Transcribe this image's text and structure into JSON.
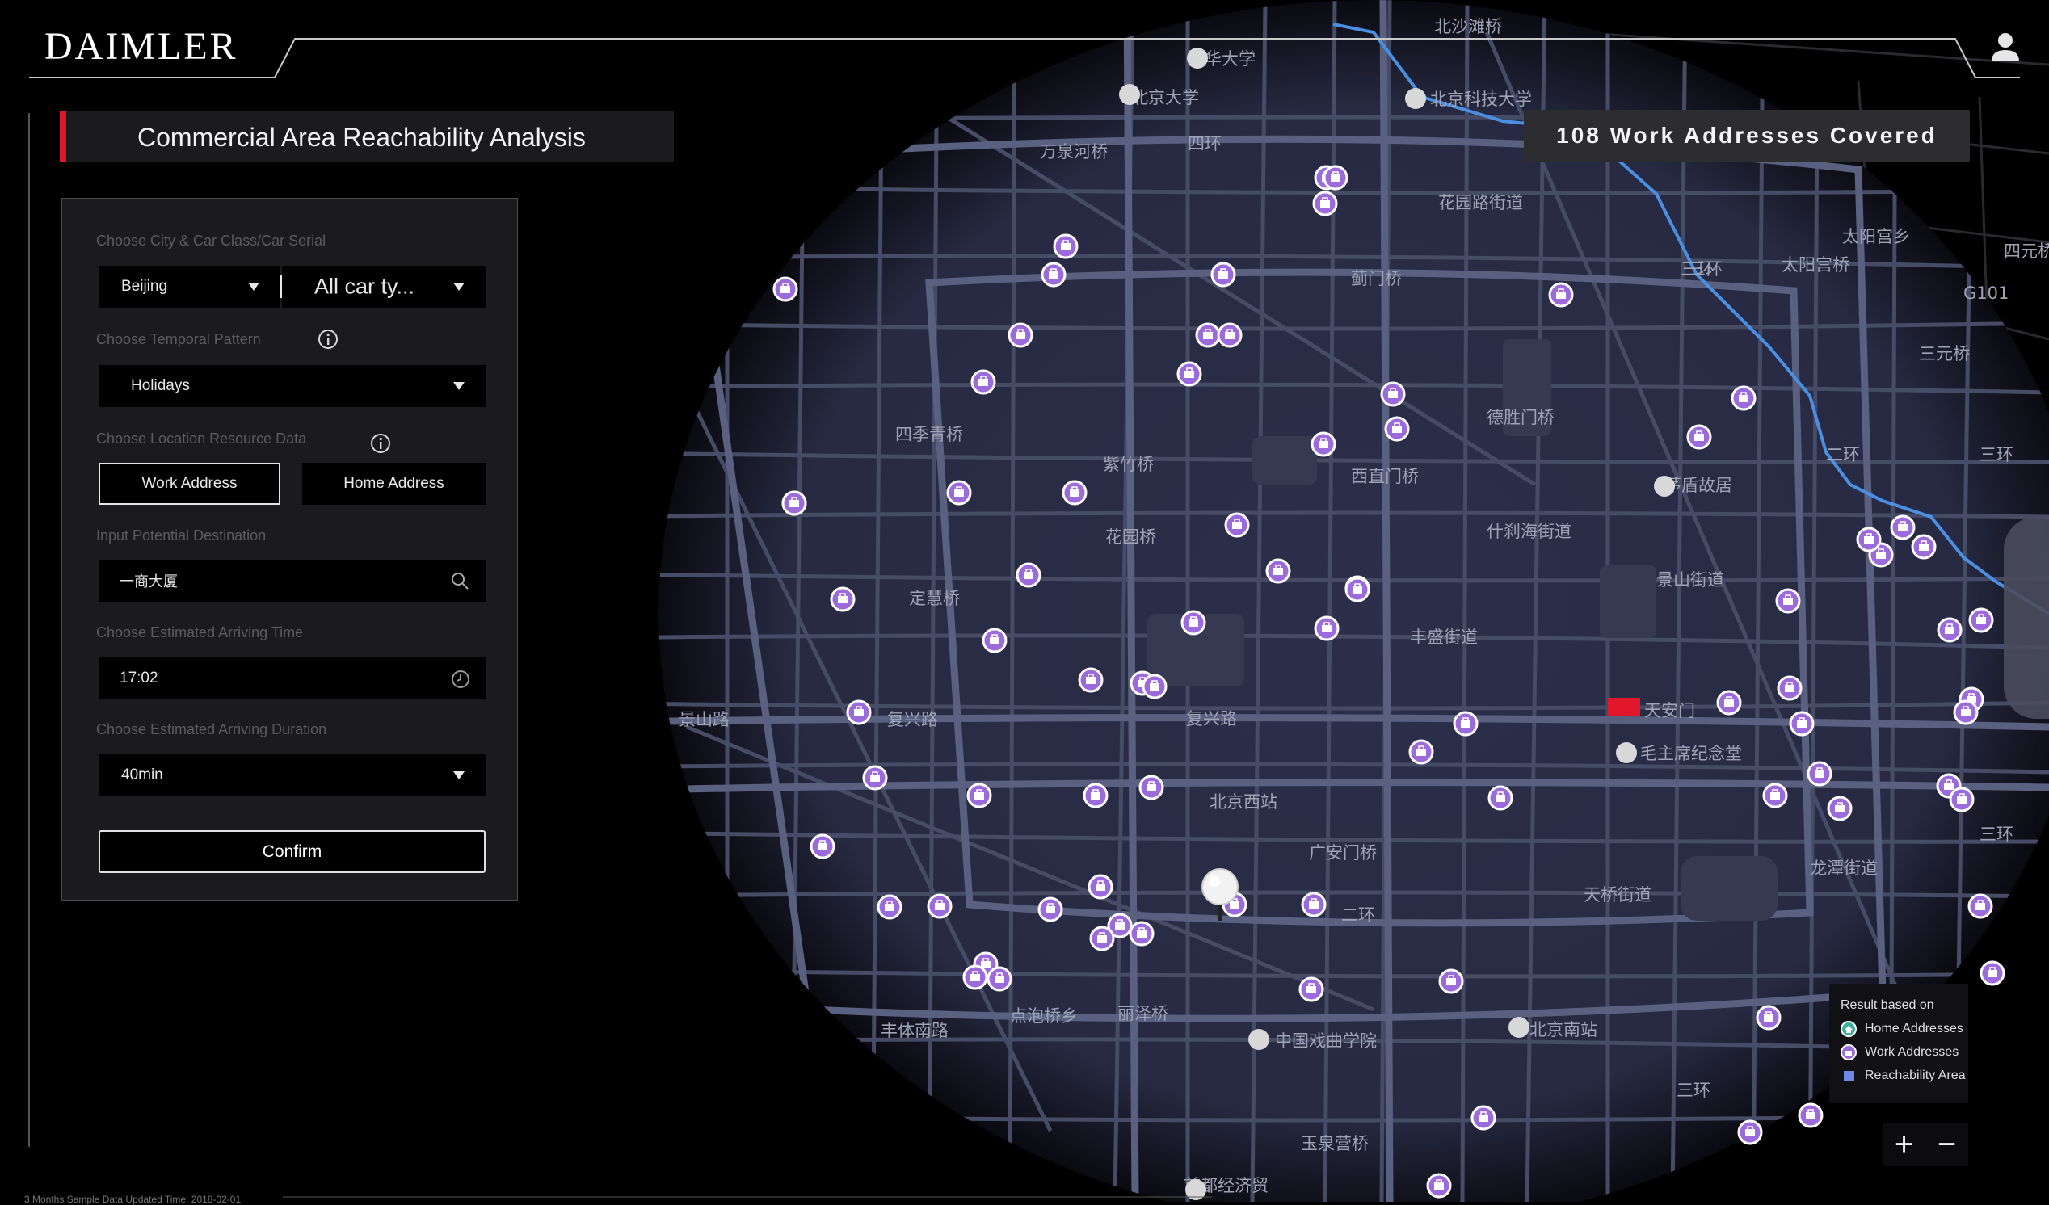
{
  "brand": {
    "logo_text": "DAIMLER"
  },
  "header": {
    "user_icon": "user-icon"
  },
  "page_title": "Commercial Area Reachability Analysis",
  "coverage_badge": "108 Work Addresses Covered",
  "panel": {
    "city_label": "Choose City & Car Class/Car Serial",
    "city_value": "Beijing",
    "car_value": "All car ty...",
    "temporal_label": "Choose Temporal Pattern",
    "temporal_value": "Holidays",
    "location_label": "Choose Location Resource Data",
    "work_address_label": "Work Address",
    "home_address_label": "Home Address",
    "selected_location": "Work Address",
    "destination_label": "Input Potential Destination",
    "destination_value": "一商大厦",
    "arriving_time_label": "Choose Estimated Arriving Time",
    "arriving_time_value": "17:02",
    "duration_label": "Choose Estimated Arriving Duration",
    "duration_value": "40min",
    "confirm_label": "Confirm"
  },
  "legend": {
    "title": "Result based on",
    "home": "Home Addresses",
    "work": "Work Addresses",
    "area": "Reachability Area",
    "home_color": "#3bb39a",
    "work_color": "#9b6bdc",
    "area_color": "#6f86e8"
  },
  "zoom": {
    "in": "+",
    "out": "−"
  },
  "footer": "3 Months Sample Data    Updated Time: 2018-02-01",
  "colors": {
    "accent_red": "#e0162b",
    "map_area": "#2a2c45",
    "road": "#4a5068",
    "river": "#4a90e2",
    "marker": "#9b6bdc"
  },
  "map": {
    "labels": [
      "北沙滩桥",
      "清华大学",
      "北京大学",
      "北京科技大学",
      "万泉河桥",
      "四环",
      "花园路街道",
      "蓟门桥",
      "三环",
      "太阳宫桥",
      "太阳宫乡",
      "三元桥",
      "四元桥",
      "四季青桥",
      "紫竹桥",
      "德胜门桥",
      "西直门桥",
      "茅盾故居",
      "什刹海街道",
      "花园桥",
      "景山街道",
      "定慧桥",
      "丰盛街道",
      "复兴路",
      "复兴路",
      "天安门",
      "毛主席纪念堂",
      "北京西站",
      "广安门桥",
      "天桥街道",
      "龙潭街道",
      "二环",
      "丰体南路",
      "点泡桥乡",
      "丽泽桥",
      "中国戏曲学院",
      "北京南站",
      "三环",
      "玉泉营桥",
      "首都经济贸",
      "三环",
      "二环",
      "三环",
      "三环",
      "G101",
      "景山路"
    ]
  }
}
